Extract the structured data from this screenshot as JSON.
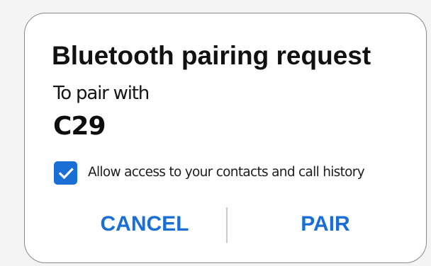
{
  "dialog": {
    "title": "Bluetooth pairing request",
    "subtitle": "To pair with",
    "device_name": "C29",
    "checkbox": {
      "checked": true,
      "label": "Allow access to your contacts and call history"
    },
    "buttons": {
      "cancel_label": "CANCEL",
      "pair_label": "PAIR"
    }
  },
  "colors": {
    "accent": "#1a6fd6",
    "dialog_background": "#ffffff",
    "page_background": "#f4f4f4",
    "text": "#111111"
  },
  "icons": {
    "checkbox": "check-icon"
  }
}
